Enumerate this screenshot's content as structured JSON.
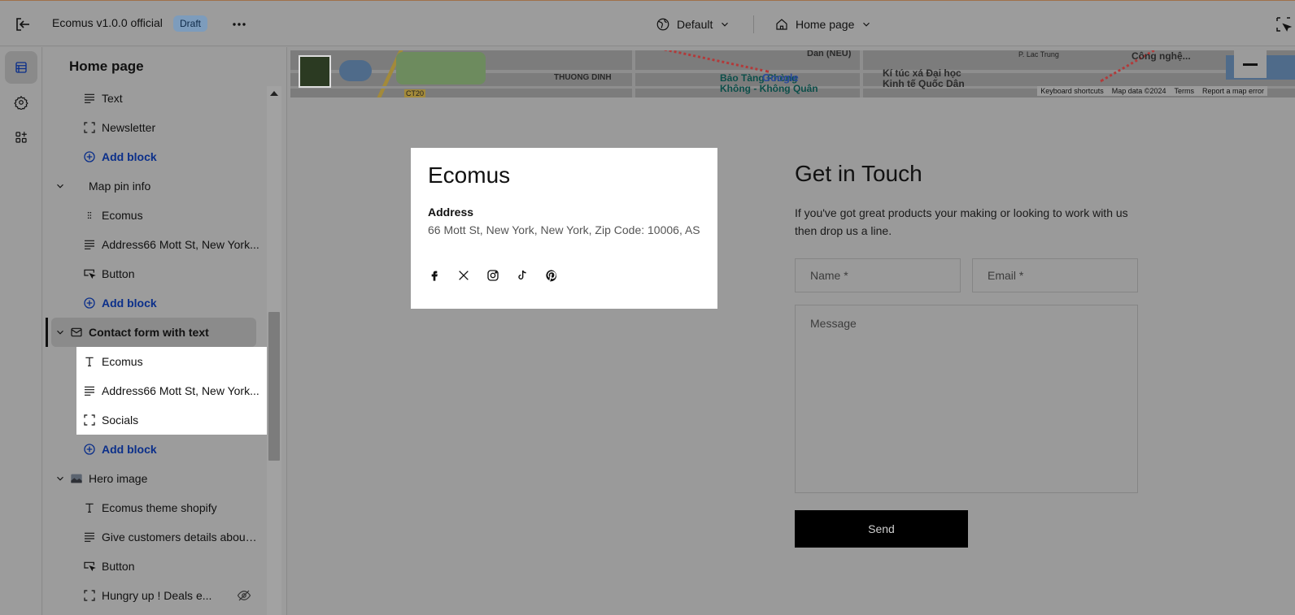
{
  "topbar": {
    "title": "Ecomus v1.0.0 official",
    "badge": "Draft",
    "theme_select": "Default",
    "page_select": "Home page"
  },
  "sidebar": {
    "title": "Home page",
    "items": [
      {
        "label": "Text",
        "icon": "text-lines-icon",
        "type": "child"
      },
      {
        "label": "Newsletter",
        "icon": "block-frame-icon",
        "type": "child"
      },
      {
        "label": "Add block",
        "icon": "plus-circle-icon",
        "type": "add"
      },
      {
        "label": "Map pin info",
        "icon": "",
        "type": "section"
      },
      {
        "label": "Ecomus",
        "icon": "drag-dots-icon",
        "type": "child"
      },
      {
        "label": "Address66 Mott St, New York...",
        "icon": "text-lines-icon",
        "type": "child"
      },
      {
        "label": "Button",
        "icon": "button-cursor-icon",
        "type": "child"
      },
      {
        "label": "Add block",
        "icon": "plus-circle-icon",
        "type": "add"
      },
      {
        "label": "Contact form with text",
        "icon": "envelope-icon",
        "type": "selected-section"
      },
      {
        "label": "Ecomus",
        "icon": "heading-t-icon",
        "type": "child-hl"
      },
      {
        "label": "Address66 Mott St, New York...",
        "icon": "text-lines-icon",
        "type": "child-hl"
      },
      {
        "label": "Socials",
        "icon": "block-frame-icon",
        "type": "child-hl"
      },
      {
        "label": "Add block",
        "icon": "plus-circle-icon",
        "type": "add"
      },
      {
        "label": "Hero image",
        "icon": "image-thumb-icon",
        "type": "section"
      },
      {
        "label": "Ecomus theme shopify",
        "icon": "heading-t-icon",
        "type": "child"
      },
      {
        "label": "Give customers details about ...",
        "icon": "text-lines-icon",
        "type": "child"
      },
      {
        "label": "Button",
        "icon": "button-cursor-icon",
        "type": "child"
      },
      {
        "label": "Hungry up ! Deals e...",
        "icon": "block-frame-icon",
        "type": "child",
        "hidden": true
      }
    ]
  },
  "map": {
    "labels": {
      "area1": "THUONG DINH",
      "area2": "Dan (NEU)",
      "area3": "P. Lac Trung",
      "area4": "Công nghệ...",
      "poi1": "Bảo Tàng Phòng Không - Không Quân",
      "poi2": "Kí túc xá Đại học Kinh tế Quốc Dân",
      "road": "CT20",
      "brand": "Google"
    },
    "attribution": [
      "Keyboard shortcuts",
      "Map data ©2024",
      "Terms",
      "Report a map error"
    ]
  },
  "card": {
    "title": "Ecomus",
    "address_heading": "Address",
    "address": "66 Mott St, New York, New York, Zip Code: 10006, AS"
  },
  "contact": {
    "title": "Get in Touch",
    "text": "If you've got great products your making or looking to work with us then drop us a line.",
    "name_placeholder": "Name *",
    "email_placeholder": "Email *",
    "message_placeholder": "Message",
    "send_label": "Send"
  }
}
